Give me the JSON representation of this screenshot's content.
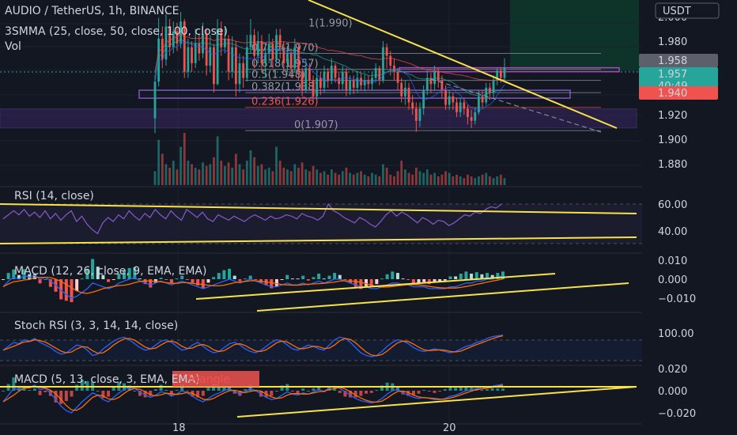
{
  "header": {
    "symbol_line": "AUDIO / TetherUS, 1h, BINANCE",
    "ma_line": "3SMMA (25, close, 50, close, 100, close)",
    "vol_label": "Vol",
    "currency": "USDT"
  },
  "badges": {
    "price_a": "1.958",
    "price_b": "1.957",
    "countdown": "40:49",
    "price_c": "1.940"
  },
  "colors": {
    "bg": "#131722",
    "up": "#26a69a",
    "down": "#ef5350",
    "trend": "#f7e24b",
    "fib_box": "#7e57c2",
    "rsi": "#7e57c2",
    "macd": "#2962ff",
    "signal": "#ff6d00"
  },
  "panes": {
    "rsi_label": "RSI (14, close)",
    "macd1_label": "MACD (12, 26, close, 9, EMA, EMA)",
    "stoch_label": "Stoch RSI (3, 3, 14, 14, close)",
    "macd2_label": "MACD (5, 13, close, 3, EMA, EMA)",
    "macd2_tag": "Triangle"
  },
  "chart_data": {
    "type": "line",
    "price_axis": [
      "2.000",
      "1.980",
      "1.960",
      "1.940",
      "1.920",
      "1.900",
      "1.880"
    ],
    "rsi_axis": [
      "60.00",
      "40.00"
    ],
    "macd1_axis": [
      "0.010",
      "0.000",
      "−0.010"
    ],
    "stoch_axis": [
      "100.00"
    ],
    "macd2_axis": [
      "0.020",
      "0.000",
      "−0.020"
    ],
    "x_ticks": [
      "18",
      "20"
    ],
    "fib_levels": [
      {
        "label": "0.786(1.970)",
        "value": 1.97
      },
      {
        "label": "0.618(1.957)",
        "value": 1.957
      },
      {
        "label": "0.5(1.948)",
        "value": 1.948
      },
      {
        "label": "0.382(1.938)",
        "value": 1.938
      },
      {
        "label": "0.236(1.926)",
        "value": 1.926
      },
      {
        "label": "0(1.907)",
        "value": 1.907
      }
    ],
    "fib_top_label": "1(1.990)",
    "candles": [
      [
        1.917,
        1.947,
        1.952,
        1.905
      ],
      [
        1.947,
        1.982,
        1.999,
        1.943
      ],
      [
        1.982,
        1.965,
        1.992,
        1.958
      ],
      [
        1.965,
        1.992,
        2.002,
        1.96
      ],
      [
        1.992,
        1.975,
        1.998,
        1.968
      ],
      [
        1.975,
        1.988,
        1.996,
        1.97
      ],
      [
        1.988,
        1.978,
        1.995,
        1.972
      ],
      [
        1.978,
        1.996,
        2.004,
        1.974
      ],
      [
        1.996,
        1.955,
        1.998,
        1.95
      ],
      [
        1.955,
        1.975,
        1.982,
        1.95
      ],
      [
        1.975,
        1.962,
        1.98,
        1.955
      ],
      [
        1.962,
        1.978,
        1.99,
        1.958
      ],
      [
        1.978,
        1.97,
        1.986,
        1.964
      ],
      [
        1.97,
        1.986,
        1.995,
        1.966
      ],
      [
        1.986,
        1.96,
        1.99,
        1.952
      ],
      [
        1.96,
        1.975,
        1.985,
        1.955
      ],
      [
        1.975,
        1.945,
        1.978,
        1.938
      ],
      [
        1.945,
        1.99,
        1.998,
        1.944
      ],
      [
        1.99,
        1.975,
        1.996,
        1.968
      ],
      [
        1.975,
        1.982,
        1.992,
        1.97
      ],
      [
        1.982,
        1.955,
        1.985,
        1.948
      ],
      [
        1.955,
        1.975,
        1.984,
        1.95
      ],
      [
        1.975,
        1.945,
        1.98,
        1.935
      ],
      [
        1.945,
        1.962,
        1.97,
        1.938
      ],
      [
        1.962,
        1.95,
        1.968,
        1.942
      ],
      [
        1.95,
        1.975,
        1.985,
        1.947
      ],
      [
        1.975,
        1.985,
        1.998,
        1.97
      ],
      [
        1.985,
        1.968,
        1.99,
        1.958
      ],
      [
        1.968,
        1.98,
        1.988,
        1.962
      ],
      [
        1.98,
        1.962,
        1.985,
        1.955
      ],
      [
        1.962,
        1.97,
        1.978,
        1.95
      ],
      [
        1.97,
        1.978,
        1.986,
        1.962
      ],
      [
        1.978,
        1.965,
        1.982,
        1.958
      ],
      [
        1.965,
        1.985,
        1.99,
        1.962
      ],
      [
        1.985,
        1.975,
        1.99,
        1.966
      ],
      [
        1.975,
        1.962,
        1.98,
        1.955
      ],
      [
        1.962,
        1.97,
        1.976,
        1.955
      ],
      [
        1.97,
        1.958,
        1.974,
        1.95
      ],
      [
        1.958,
        1.975,
        1.982,
        1.954
      ],
      [
        1.975,
        1.955,
        1.978,
        1.948
      ],
      [
        1.955,
        1.94,
        1.958,
        1.935
      ],
      [
        1.94,
        1.958,
        1.965,
        1.938
      ],
      [
        1.958,
        1.948,
        1.962,
        1.942
      ],
      [
        1.948,
        1.935,
        1.952,
        1.93
      ],
      [
        1.935,
        1.95,
        1.957,
        1.932
      ],
      [
        1.95,
        1.942,
        1.955,
        1.936
      ],
      [
        1.942,
        1.955,
        1.96,
        1.938
      ],
      [
        1.955,
        1.948,
        1.958,
        1.942
      ],
      [
        1.948,
        1.96,
        1.966,
        1.945
      ],
      [
        1.96,
        1.95,
        1.962,
        1.946
      ],
      [
        1.95,
        1.945,
        1.955,
        1.94
      ],
      [
        1.945,
        1.955,
        1.96,
        1.94
      ],
      [
        1.955,
        1.94,
        1.958,
        1.935
      ],
      [
        1.94,
        1.948,
        1.952,
        1.936
      ],
      [
        1.948,
        1.942,
        1.952,
        1.937
      ],
      [
        1.942,
        1.95,
        1.955,
        1.938
      ],
      [
        1.95,
        1.944,
        1.954,
        1.94
      ],
      [
        1.944,
        1.948,
        1.953,
        1.939
      ],
      [
        1.948,
        1.945,
        1.952,
        1.941
      ],
      [
        1.945,
        1.95,
        1.955,
        1.94
      ],
      [
        1.95,
        1.958,
        1.962,
        1.946
      ],
      [
        1.958,
        1.948,
        1.96,
        1.944
      ],
      [
        1.948,
        1.975,
        1.98,
        1.946
      ],
      [
        1.975,
        1.968,
        1.978,
        1.958
      ],
      [
        1.968,
        1.96,
        1.972,
        1.952
      ],
      [
        1.96,
        1.955,
        1.966,
        1.948
      ],
      [
        1.955,
        1.946,
        1.958,
        1.94
      ],
      [
        1.946,
        1.935,
        1.95,
        1.93
      ],
      [
        1.935,
        1.942,
        1.948,
        1.928
      ],
      [
        1.942,
        1.93,
        1.946,
        1.924
      ],
      [
        1.93,
        1.925,
        1.936,
        1.92
      ],
      [
        1.925,
        1.915,
        1.93,
        1.906
      ],
      [
        1.915,
        1.925,
        1.93,
        1.91
      ],
      [
        1.925,
        1.94,
        1.944,
        1.92
      ],
      [
        1.94,
        1.95,
        1.956,
        1.936
      ],
      [
        1.95,
        1.945,
        1.954,
        1.938
      ],
      [
        1.945,
        1.955,
        1.96,
        1.94
      ],
      [
        1.955,
        1.948,
        1.958,
        1.942
      ],
      [
        1.948,
        1.94,
        1.952,
        1.934
      ],
      [
        1.94,
        1.928,
        1.944,
        1.924
      ],
      [
        1.928,
        1.935,
        1.94,
        1.924
      ],
      [
        1.935,
        1.93,
        1.938,
        1.924
      ],
      [
        1.93,
        1.922,
        1.934,
        1.918
      ],
      [
        1.922,
        1.93,
        1.934,
        1.918
      ],
      [
        1.93,
        1.925,
        1.934,
        1.92
      ],
      [
        1.925,
        1.918,
        1.928,
        1.912
      ],
      [
        1.918,
        1.915,
        1.924,
        1.909
      ],
      [
        1.915,
        1.922,
        1.926,
        1.912
      ],
      [
        1.922,
        1.935,
        1.94,
        1.92
      ],
      [
        1.935,
        1.93,
        1.94,
        1.926
      ],
      [
        1.93,
        1.942,
        1.946,
        1.928
      ],
      [
        1.942,
        1.938,
        1.946,
        1.932
      ],
      [
        1.938,
        1.948,
        1.952,
        1.934
      ],
      [
        1.948,
        1.956,
        1.958,
        1.944
      ],
      [
        1.956,
        1.95,
        1.958,
        1.946
      ],
      [
        1.95,
        1.958,
        1.966,
        1.948
      ]
    ],
    "volumes": [
      8,
      26,
      18,
      12,
      10,
      14,
      9,
      22,
      30,
      14,
      12,
      10,
      9,
      13,
      11,
      12,
      16,
      28,
      14,
      11,
      13,
      10,
      18,
      12,
      9,
      14,
      20,
      16,
      11,
      12,
      9,
      10,
      8,
      22,
      14,
      10,
      9,
      8,
      12,
      10,
      13,
      9,
      8,
      11,
      9,
      7,
      8,
      6,
      9,
      7,
      6,
      8,
      10,
      7,
      6,
      7,
      8,
      6,
      5,
      7,
      6,
      5,
      12,
      10,
      6,
      5,
      8,
      14,
      9,
      7,
      6,
      10,
      8,
      7,
      9,
      6,
      7,
      5,
      6,
      8,
      7,
      5,
      6,
      5,
      4,
      6,
      5,
      4,
      5,
      6,
      7,
      5,
      4,
      5,
      6,
      4
    ],
    "rsi": [
      49,
      52,
      55,
      52,
      56,
      51,
      54,
      50,
      55,
      49,
      53,
      48,
      52,
      55,
      47,
      51,
      45,
      41,
      38,
      46,
      50,
      47,
      52,
      49,
      55,
      51,
      48,
      53,
      50,
      56,
      52,
      49,
      55,
      51,
      48,
      56,
      53,
      50,
      54,
      49,
      47,
      52,
      50,
      48,
      51,
      49,
      47,
      50,
      52,
      50,
      48,
      51,
      49,
      50,
      52,
      51,
      49,
      53,
      51,
      50,
      48,
      51,
      60,
      55,
      53,
      50,
      48,
      46,
      50,
      48,
      45,
      43,
      47,
      52,
      55,
      51,
      54,
      52,
      49,
      46,
      50,
      48,
      45,
      48,
      47,
      44,
      46,
      49,
      52,
      51,
      54,
      53,
      56,
      58,
      57,
      60
    ],
    "macd1_line": [
      -0.004,
      -0.001,
      0.001,
      0.0,
      0.002,
      0.001,
      0.002,
      0.0,
      0.001,
      -0.001,
      -0.003,
      -0.006,
      -0.008,
      -0.01,
      -0.009,
      -0.007,
      -0.005,
      -0.002,
      -0.003,
      -0.004,
      -0.005,
      -0.004,
      -0.002,
      -0.001,
      0.0,
      0.001,
      -0.001,
      -0.002,
      -0.003,
      -0.002,
      -0.001,
      -0.002,
      -0.003,
      -0.002,
      -0.001,
      -0.002,
      -0.003,
      -0.004,
      -0.005,
      -0.004,
      -0.003,
      -0.002,
      -0.001,
      0.0,
      -0.001,
      -0.002,
      -0.001,
      0.0,
      -0.001,
      -0.002,
      -0.003,
      -0.004,
      -0.004,
      -0.003,
      -0.002,
      -0.003,
      -0.003,
      -0.002,
      -0.003,
      -0.002,
      -0.001,
      -0.002,
      -0.001,
      0.0,
      0.0,
      -0.001,
      -0.002,
      -0.003,
      -0.004,
      -0.004,
      -0.005,
      -0.005,
      -0.004,
      -0.003,
      -0.002,
      -0.002,
      -0.003,
      -0.003,
      -0.004,
      -0.004,
      -0.004,
      -0.005,
      -0.005,
      -0.005,
      -0.005,
      -0.004,
      -0.004,
      -0.003,
      -0.002,
      -0.002,
      -0.001,
      -0.001,
      0.0,
      0.0,
      0.001,
      0.002
    ],
    "stoch_k": [
      40,
      55,
      70,
      65,
      80,
      75,
      85,
      70,
      60,
      50,
      35,
      25,
      30,
      45,
      60,
      55,
      40,
      20,
      25,
      45,
      60,
      75,
      85,
      90,
      80,
      65,
      50,
      40,
      45,
      60,
      75,
      80,
      70,
      55,
      40,
      45,
      60,
      70,
      55,
      40,
      30,
      35,
      50,
      65,
      70,
      60,
      45,
      35,
      30,
      40,
      55,
      70,
      80,
      75,
      60,
      45,
      40,
      50,
      60,
      55,
      45,
      40,
      60,
      80,
      90,
      85,
      70,
      50,
      30,
      20,
      15,
      20,
      35,
      55,
      70,
      80,
      75,
      65,
      50,
      40,
      35,
      40,
      45,
      40,
      35,
      30,
      35,
      45,
      55,
      60,
      70,
      75,
      85,
      92,
      95,
      98
    ],
    "macd2_line": [
      -0.01,
      -0.004,
      0.002,
      0.001,
      0.004,
      0.003,
      0.005,
      0.001,
      0.002,
      -0.002,
      -0.008,
      -0.014,
      -0.018,
      -0.02,
      -0.015,
      -0.01,
      -0.006,
      -0.002,
      -0.004,
      -0.008,
      -0.01,
      -0.006,
      -0.002,
      0.001,
      0.003,
      0.002,
      -0.001,
      -0.004,
      -0.006,
      -0.004,
      -0.001,
      -0.002,
      -0.005,
      -0.003,
      0.0,
      -0.002,
      -0.005,
      -0.008,
      -0.01,
      -0.007,
      -0.004,
      -0.002,
      0.0,
      0.002,
      -0.001,
      -0.003,
      -0.001,
      0.002,
      0.0,
      -0.003,
      -0.006,
      -0.008,
      -0.007,
      -0.004,
      -0.001,
      -0.003,
      -0.004,
      -0.002,
      -0.003,
      -0.001,
      0.001,
      -0.001,
      0.003,
      0.004,
      0.002,
      -0.001,
      -0.004,
      -0.007,
      -0.009,
      -0.01,
      -0.011,
      -0.01,
      -0.007,
      -0.003,
      0.0,
      0.001,
      -0.002,
      -0.004,
      -0.006,
      -0.007,
      -0.006,
      -0.007,
      -0.008,
      -0.008,
      -0.007,
      -0.005,
      -0.004,
      -0.002,
      0.0,
      0.001,
      0.002,
      0.002,
      0.003,
      0.004,
      0.005,
      0.006
    ]
  }
}
